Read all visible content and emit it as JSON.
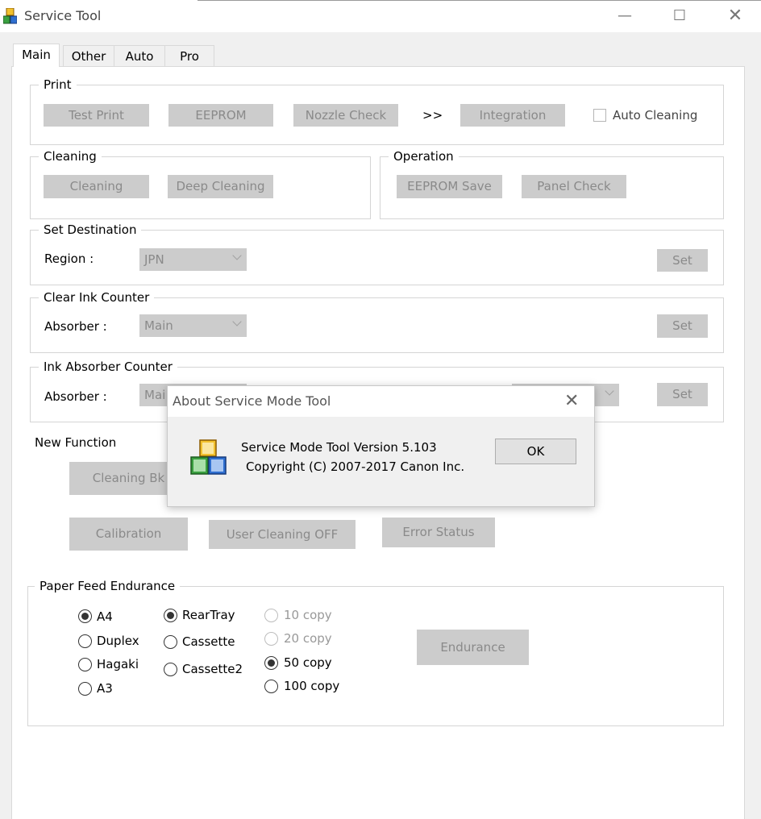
{
  "window": {
    "title": "Service Tool",
    "min": "—",
    "max": "☐",
    "close": "✕"
  },
  "tabs": [
    {
      "label": "Main"
    },
    {
      "label": "Other"
    },
    {
      "label": "Auto"
    },
    {
      "label": "Pro"
    }
  ],
  "print": {
    "legend": "Print",
    "test_print": "Test Print",
    "eeprom": "EEPROM",
    "nozzle_check": "Nozzle Check",
    "arrow": ">>",
    "integration": "Integration",
    "auto_cleaning": "Auto Cleaning"
  },
  "cleaning": {
    "legend": "Cleaning",
    "cleaning": "Cleaning",
    "deep_cleaning": "Deep Cleaning"
  },
  "operation": {
    "legend": "Operation",
    "eeprom_save": "EEPROM Save",
    "panel_check": "Panel Check"
  },
  "set_destination": {
    "legend": "Set Destination",
    "label": "Region :",
    "value": "JPN",
    "set": "Set"
  },
  "clear_ink_counter": {
    "legend": "Clear Ink Counter",
    "label": "Absorber :",
    "value": "Main",
    "set": "Set"
  },
  "ink_absorber_counter": {
    "legend": "Ink Absorber Counter",
    "label": "Absorber :",
    "value": "Mai",
    "set": "Set"
  },
  "new_function": {
    "label": "New Function",
    "cleaning_bk": "Cleaning Bk",
    "calibration": "Calibration",
    "user_cleaning_off": "User Cleaning OFF",
    "error_status": "Error Status"
  },
  "paper_feed": {
    "legend": "Paper Feed Endurance",
    "sizes": [
      {
        "label": "A4",
        "checked": true
      },
      {
        "label": "Duplex",
        "checked": false
      },
      {
        "label": "Hagaki",
        "checked": false
      },
      {
        "label": "A3",
        "checked": false
      }
    ],
    "trays": [
      {
        "label": "RearTray",
        "checked": true
      },
      {
        "label": "Cassette",
        "checked": false
      },
      {
        "label": "Cassette2",
        "checked": false
      }
    ],
    "copies": [
      {
        "label": "10 copy",
        "checked": false,
        "disabled": true
      },
      {
        "label": "20 copy",
        "checked": false,
        "disabled": true
      },
      {
        "label": "50 copy",
        "checked": true,
        "disabled": false
      },
      {
        "label": "100 copy",
        "checked": false,
        "disabled": false
      }
    ],
    "endurance": "Endurance"
  },
  "about_dialog": {
    "title": "About Service Mode Tool",
    "close": "✕",
    "line1": "Service Mode Tool  Version 5.103",
    "line2": "Copyright (C) 2007-2017 Canon Inc.",
    "ok": "OK"
  }
}
